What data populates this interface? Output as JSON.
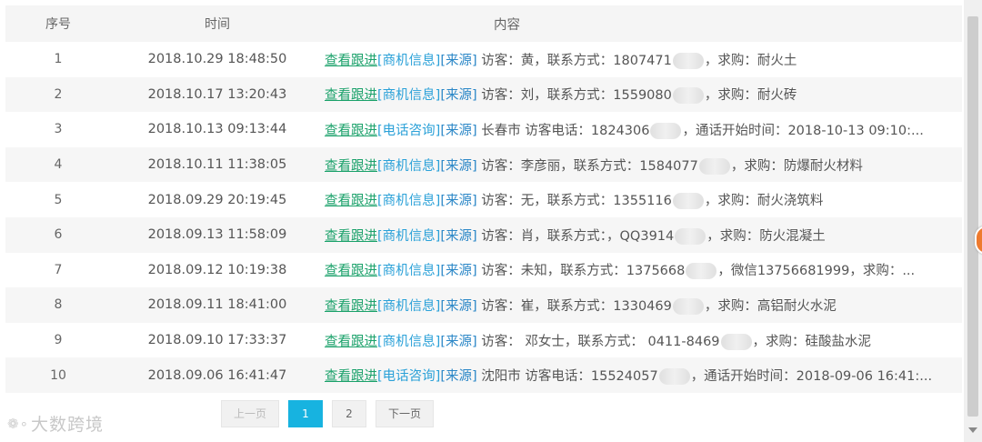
{
  "header": {
    "idx": "序号",
    "time": "时间",
    "content": "内容"
  },
  "rows": [
    {
      "idx": "1",
      "time": "2018.10.29 18:48:50",
      "follow": "查看跟进",
      "tag": "[商机信息]",
      "src": "[来源]",
      "pre": " 访客：黄，联系方式：1807471",
      "post": "，求购：耐火土"
    },
    {
      "idx": "2",
      "time": "2018.10.17 13:20:43",
      "follow": "查看跟进",
      "tag": "[商机信息]",
      "src": "[来源]",
      "pre": " 访客：刘，联系方式：1559080",
      "post": "，求购：耐火砖"
    },
    {
      "idx": "3",
      "time": "2018.10.13 09:13:44",
      "follow": "查看跟进",
      "tag": "[电话咨询]",
      "src": "[来源]",
      "pre": " 长春市 访客电话：1824306",
      "post": "，通话开始时间：2018-10-13 09:10:..."
    },
    {
      "idx": "4",
      "time": "2018.10.11 11:38:05",
      "follow": "查看跟进",
      "tag": "[商机信息]",
      "src": "[来源]",
      "pre": " 访客：李彦丽，联系方式：1584077",
      "post": "，求购：防爆耐火材料"
    },
    {
      "idx": "5",
      "time": "2018.09.29 20:19:45",
      "follow": "查看跟进",
      "tag": "[商机信息]",
      "src": "[来源]",
      "pre": " 访客：无，联系方式：1355116",
      "post": "，求购：耐火浇筑料"
    },
    {
      "idx": "6",
      "time": "2018.09.13 11:58:09",
      "follow": "查看跟进",
      "tag": "[商机信息]",
      "src": "[来源]",
      "pre": " 访客：肖，联系方式：，QQ3914",
      "post": "，求购：防火混凝土"
    },
    {
      "idx": "7",
      "time": "2018.09.12 10:19:38",
      "follow": "查看跟进",
      "tag": "[商机信息]",
      "src": "[来源]",
      "pre": " 访客：未知，联系方式：1375668",
      "post": "，微信13756681999，求购：..."
    },
    {
      "idx": "8",
      "time": "2018.09.11 18:41:00",
      "follow": "查看跟进",
      "tag": "[商机信息]",
      "src": "[来源]",
      "pre": " 访客：崔，联系方式：1330469",
      "post": "，求购：高铝耐火水泥"
    },
    {
      "idx": "9",
      "time": "2018.09.10 17:33:37",
      "follow": "查看跟进",
      "tag": "[商机信息]",
      "src": "[来源]",
      "pre": " 访客： 邓女士，联系方式： 0411-8469",
      "post": "，求购：硅酸盐水泥"
    },
    {
      "idx": "10",
      "time": "2018.09.06 16:41:47",
      "follow": "查看跟进",
      "tag": "[电话咨询]",
      "src": "[来源]",
      "pre": " 沈阳市 访客电话：15524057",
      "post": "，通话开始时间：2018-09-06 16:41:..."
    }
  ],
  "pager": {
    "prev": "上一页",
    "page1": "1",
    "page2": "2",
    "next": "下一页"
  },
  "watermark": "大数跨境"
}
